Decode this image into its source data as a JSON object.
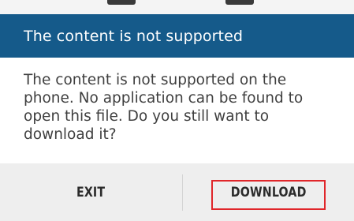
{
  "dialog": {
    "title": "The content is not supported",
    "message": "The content is not supported on the phone. No application can be found to open this file. Do you still want to download it?",
    "buttons": {
      "exit_label": "EXIT",
      "download_label": "DOWNLOAD"
    },
    "highlighted_button": "DOWNLOAD"
  },
  "colors": {
    "title_bar": "#155a8a",
    "title_text": "#ffffff",
    "body_background": "#ffffff",
    "button_bar": "#eeeeee",
    "highlight": "#e0262a"
  }
}
